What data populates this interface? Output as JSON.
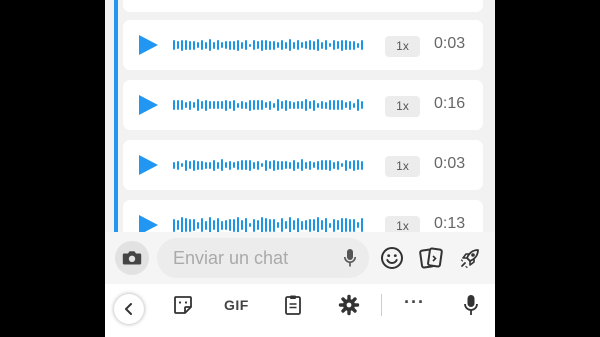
{
  "messages": [
    {
      "speed": "1x",
      "duration": "0:03"
    },
    {
      "speed": "1x",
      "duration": "0:16"
    },
    {
      "speed": "1x",
      "duration": "0:03"
    },
    {
      "speed": "1x",
      "duration": "0:13"
    }
  ],
  "composer": {
    "placeholder": "Enviar un chat"
  },
  "keyboard": {
    "gif_label": "GIF",
    "more_label": "···"
  },
  "colors": {
    "accent": "#2196f3",
    "waveform": "#1e96e6"
  },
  "icons": [
    "camera-icon",
    "mic-icon",
    "smiley-icon",
    "sticker-cards-icon",
    "rocket-icon",
    "chevron-left-icon",
    "sticker-icon",
    "clipboard-icon",
    "gear-icon",
    "keyboard-mic-icon"
  ]
}
